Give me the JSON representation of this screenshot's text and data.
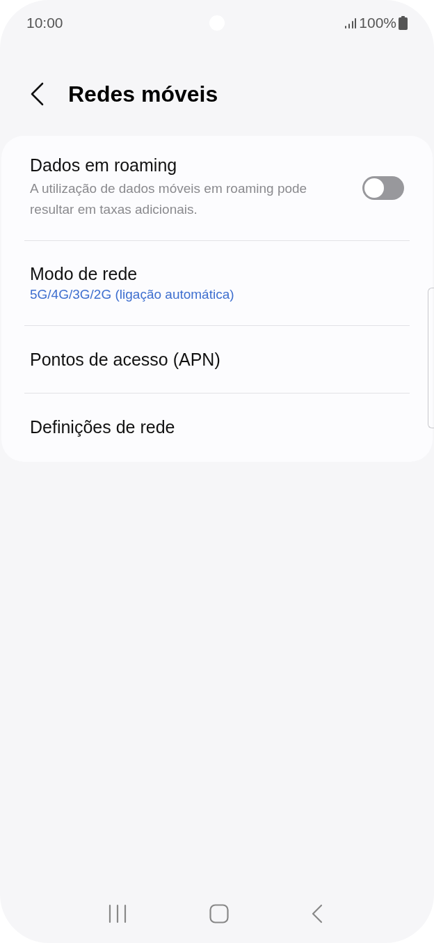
{
  "status_bar": {
    "time": "10:00",
    "battery": "100%"
  },
  "header": {
    "title": "Redes móveis"
  },
  "items": [
    {
      "kind": "toggle",
      "title": "Dados em roaming",
      "description": "A utilização de dados móveis em roaming pode resultar em taxas adicionais.",
      "on": false
    },
    {
      "kind": "value",
      "title": "Modo de rede",
      "value": "5G/4G/3G/2G (ligação automática)"
    },
    {
      "kind": "plain",
      "title": "Pontos de acesso (APN)"
    },
    {
      "kind": "plain",
      "title": "Definições de rede"
    }
  ]
}
